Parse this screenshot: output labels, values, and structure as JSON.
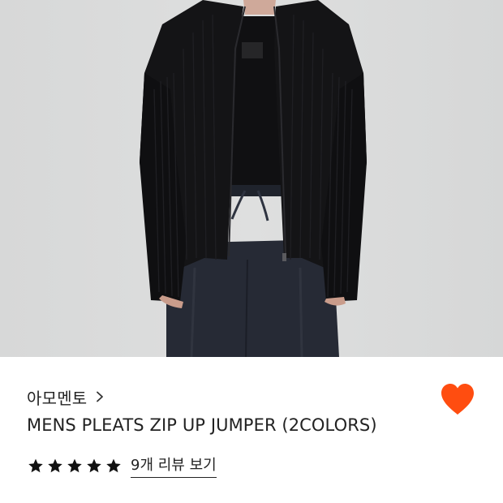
{
  "product": {
    "image_alt": "MENS PLEATS ZIP UP JUMPER (2COLORS)",
    "brand": "아모멘토",
    "title": "MENS PLEATS ZIP UP JUMPER (2COLORS)",
    "rating": 5,
    "rating_max": 5,
    "review_link": "9개 리뷰 보기",
    "liked": true
  },
  "icons": {
    "brand_chevron": "chevron-right-icon",
    "like": "heart-icon",
    "star": "star-icon"
  },
  "colors": {
    "heart": "#ff4d10",
    "star": "#111111",
    "text": "#222222",
    "photo_background": "#d9dada",
    "jacket": "#141416",
    "trousers": "#262a35"
  }
}
